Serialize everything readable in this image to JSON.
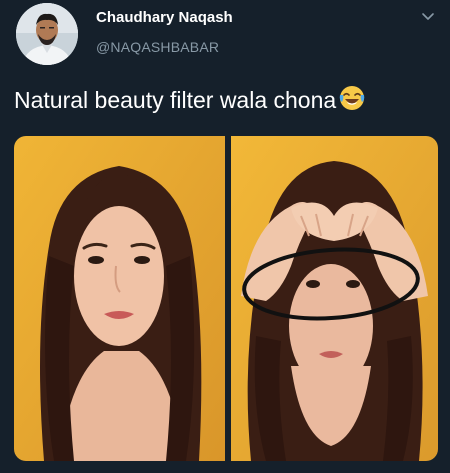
{
  "tweet": {
    "author_name": "Chaudhary Naqash",
    "author_handle": "@NAQASHBABAR",
    "text": "Natural beauty filter wala chona",
    "emoji": "face-with-tears-of-joy-icon",
    "media": [
      {
        "alt": "",
        "icon": "photo-left"
      },
      {
        "alt": "",
        "icon": "photo-right"
      }
    ]
  },
  "colors": {
    "background": "#15202b",
    "text": "#ffffff",
    "secondary": "#8899a6",
    "photo_bg": "#e8a52e"
  }
}
